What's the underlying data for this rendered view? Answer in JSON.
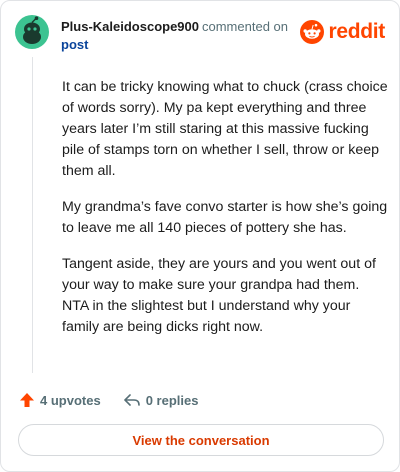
{
  "header": {
    "username": "Plus-Kaleidoscope900",
    "action": "commented on",
    "post_link": "post",
    "brand": "reddit"
  },
  "comment": {
    "paragraphs": [
      "It can be tricky knowing what to chuck (crass choice of words sorry). My pa kept everything and three years later I’m still staring at this massive fucking pile of stamps torn on whether I sell, throw or keep them all.",
      "My grandma’s fave convo starter is how she’s going to leave me all 140 pieces of pottery she has.",
      "Tangent aside, they are yours and you went out of your way to make sure your grandpa had them. NTA in the slightest but I understand why your family are being dicks right now."
    ]
  },
  "footer": {
    "upvotes": "4 upvotes",
    "replies": "0 replies"
  },
  "cta": {
    "label": "View the conversation"
  },
  "colors": {
    "brand": "#ff4500",
    "link": "#0a449b",
    "avatar": "#3cc391",
    "cta_text": "#d93a00"
  }
}
